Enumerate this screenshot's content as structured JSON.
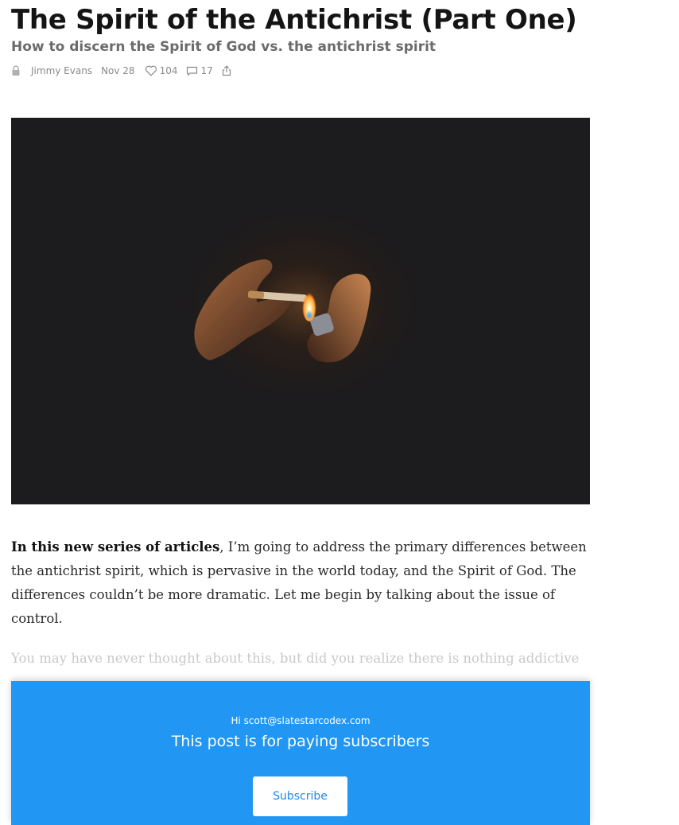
{
  "post": {
    "title": "The Spirit of the Antichrist (Part One)",
    "subtitle": "How to discern the Spirit of God vs. the antichrist spirit",
    "meta": {
      "lock_icon": "lock-icon",
      "author": "Jimmy Evans",
      "date": "Nov 28",
      "likes": "104",
      "comments": "17",
      "share_icon": "share-icon"
    },
    "hero_image": {
      "description_icon": "lighter-flame-image"
    },
    "intro_bold": "In this new series of articles",
    "intro_rest": ", I’m going to address the primary differences between the antichrist spirit, which is pervasive in the world today, and the Spirit of God. The differences couldn’t be more dramatic. Let me begin by talking about the issue of control.",
    "faded_paragraph": "You may have never thought about this, but did you realize there is nothing addictive"
  },
  "paywall": {
    "greeting_prefix": "Hi ",
    "email": "scott@slatestarcodex.com",
    "heading": "This post is for paying subscribers",
    "subscribe_label": "Subscribe"
  },
  "colors": {
    "paywall_bg": "#2196f3",
    "subscribe_text": "#1e88e5",
    "hero_bg": "#1c1b1d"
  }
}
